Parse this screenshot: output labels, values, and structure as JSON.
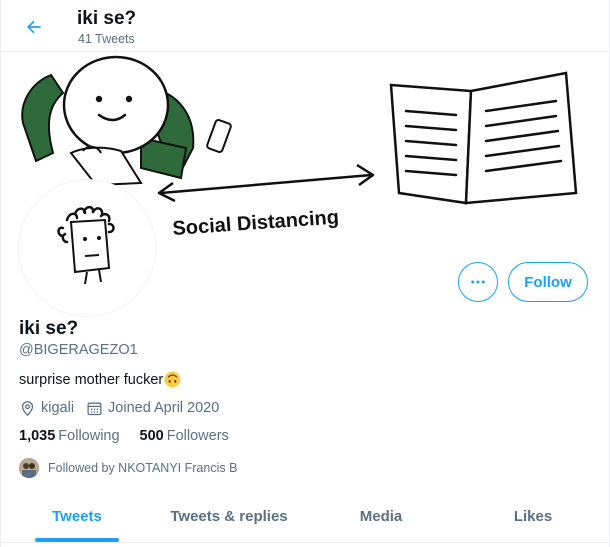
{
  "header": {
    "title": "iki se?",
    "tweet_count": "41 Tweets"
  },
  "banner": {
    "caption": "Social Distancing"
  },
  "profile": {
    "name": "iki se?",
    "handle": "@BIGERAGEZO1",
    "bio": "surprise mother fucker",
    "location": "kigali",
    "joined": "Joined April 2020",
    "following_count": "1,035",
    "following_label": "Following",
    "followers_count": "500",
    "followers_label": "Followers",
    "followed_by": "Followed by NKOTANYI Francis B"
  },
  "actions": {
    "follow_label": "Follow",
    "more_icon": "more-horizontal-icon"
  },
  "tabs": [
    {
      "label": "Tweets",
      "active": true
    },
    {
      "label": "Tweets & replies",
      "active": false
    },
    {
      "label": "Media",
      "active": false
    },
    {
      "label": "Likes",
      "active": false
    }
  ],
  "colors": {
    "accent": "#1da1f2",
    "secondary_text": "#5b7083",
    "primary_text": "#0f1419",
    "banner_green": "#2f6b3a"
  }
}
